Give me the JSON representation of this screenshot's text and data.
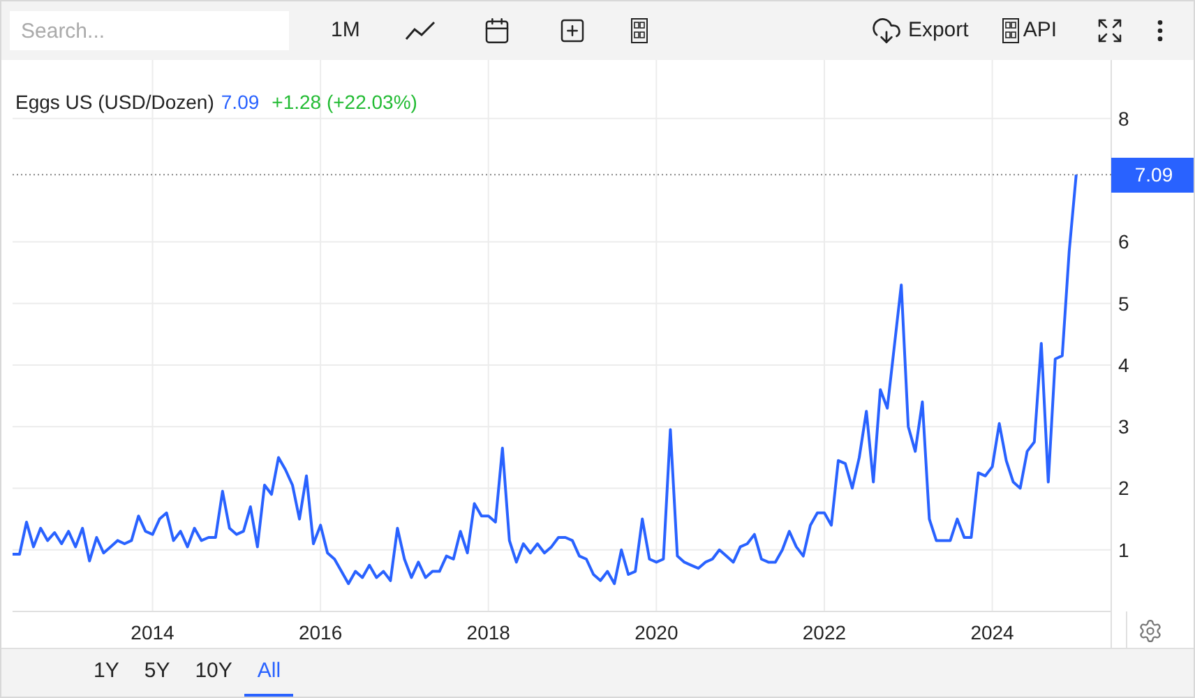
{
  "toolbar": {
    "search": {
      "placeholder": "Search..."
    },
    "interval": "1M",
    "export": "Export",
    "api": "API"
  },
  "legend": {
    "value": "7.09",
    "change": "+1.28 (+22.03%)"
  },
  "price_tag": "7.09",
  "chart_data": {
    "type": "line",
    "x": [
      "2012-05",
      "2012-06",
      "2012-07",
      "2012-08",
      "2012-09",
      "2012-10",
      "2012-11",
      "2012-12",
      "2013-01",
      "2013-02",
      "2013-03",
      "2013-04",
      "2013-05",
      "2013-06",
      "2013-07",
      "2013-08",
      "2013-09",
      "2013-10",
      "2013-11",
      "2013-12",
      "2014-01",
      "2014-02",
      "2014-03",
      "2014-04",
      "2014-05",
      "2014-06",
      "2014-07",
      "2014-08",
      "2014-09",
      "2014-10",
      "2014-11",
      "2014-12",
      "2015-01",
      "2015-02",
      "2015-03",
      "2015-04",
      "2015-05",
      "2015-06",
      "2015-07",
      "2015-08",
      "2015-09",
      "2015-10",
      "2015-11",
      "2015-12",
      "2016-01",
      "2016-02",
      "2016-03",
      "2016-04",
      "2016-05",
      "2016-06",
      "2016-07",
      "2016-08",
      "2016-09",
      "2016-10",
      "2016-11",
      "2016-12",
      "2017-01",
      "2017-02",
      "2017-03",
      "2017-04",
      "2017-05",
      "2017-06",
      "2017-07",
      "2017-08",
      "2017-09",
      "2017-10",
      "2017-11",
      "2017-12",
      "2018-01",
      "2018-02",
      "2018-03",
      "2018-04",
      "2018-05",
      "2018-06",
      "2018-07",
      "2018-08",
      "2018-09",
      "2018-10",
      "2018-11",
      "2018-12",
      "2019-01",
      "2019-02",
      "2019-03",
      "2019-04",
      "2019-05",
      "2019-06",
      "2019-07",
      "2019-08",
      "2019-09",
      "2019-10",
      "2019-11",
      "2019-12",
      "2020-01",
      "2020-02",
      "2020-03",
      "2020-04",
      "2020-05",
      "2020-06",
      "2020-07",
      "2020-08",
      "2020-09",
      "2020-10",
      "2020-11",
      "2020-12",
      "2021-01",
      "2021-02",
      "2021-03",
      "2021-04",
      "2021-05",
      "2021-06",
      "2021-07",
      "2021-08",
      "2021-09",
      "2021-10",
      "2021-11",
      "2021-12",
      "2022-01",
      "2022-02",
      "2022-03",
      "2022-04",
      "2022-05",
      "2022-06",
      "2022-07",
      "2022-08",
      "2022-09",
      "2022-10",
      "2022-11",
      "2022-12",
      "2023-01",
      "2023-02",
      "2023-03",
      "2023-04",
      "2023-05",
      "2023-06",
      "2023-07",
      "2023-08",
      "2023-09",
      "2023-10",
      "2023-11",
      "2023-12",
      "2024-01",
      "2024-02",
      "2024-03",
      "2024-04",
      "2024-05",
      "2024-06",
      "2024-07",
      "2024-08",
      "2024-09",
      "2024-10",
      "2024-11",
      "2024-12",
      "2025-01"
    ],
    "series": [
      {
        "name": "Eggs US (USD/Dozen)",
        "color": "#2962ff",
        "values": [
          0.93,
          0.93,
          1.45,
          1.05,
          1.35,
          1.15,
          1.28,
          1.1,
          1.3,
          1.05,
          1.35,
          0.82,
          1.2,
          0.95,
          1.05,
          1.15,
          1.1,
          1.15,
          1.55,
          1.3,
          1.25,
          1.5,
          1.6,
          1.15,
          1.3,
          1.05,
          1.35,
          1.15,
          1.2,
          1.2,
          1.95,
          1.35,
          1.25,
          1.3,
          1.7,
          1.05,
          2.05,
          1.9,
          2.5,
          2.3,
          2.05,
          1.5,
          2.2,
          1.1,
          1.4,
          0.95,
          0.85,
          0.65,
          0.45,
          0.65,
          0.55,
          0.75,
          0.55,
          0.65,
          0.5,
          1.35,
          0.85,
          0.55,
          0.8,
          0.55,
          0.65,
          0.65,
          0.9,
          0.85,
          1.3,
          0.95,
          1.75,
          1.55,
          1.55,
          1.45,
          2.65,
          1.15,
          0.8,
          1.1,
          0.95,
          1.1,
          0.95,
          1.05,
          1.2,
          1.2,
          1.15,
          0.9,
          0.85,
          0.6,
          0.5,
          0.65,
          0.45,
          1.0,
          0.6,
          0.65,
          1.5,
          0.85,
          0.8,
          0.85,
          2.95,
          0.9,
          0.8,
          0.75,
          0.7,
          0.8,
          0.85,
          1.0,
          0.9,
          0.8,
          1.05,
          1.1,
          1.25,
          0.85,
          0.8,
          0.8,
          1.0,
          1.3,
          1.05,
          0.9,
          1.4,
          1.6,
          1.6,
          1.4,
          2.45,
          2.4,
          2.0,
          2.5,
          3.25,
          2.1,
          3.6,
          3.3,
          4.3,
          5.3,
          3.0,
          2.6,
          3.4,
          1.5,
          1.15,
          1.15,
          1.15,
          1.5,
          1.2,
          1.2,
          2.25,
          2.2,
          2.35,
          3.05,
          2.45,
          2.1,
          2.0,
          2.6,
          2.75,
          4.35,
          2.1,
          4.1,
          4.15,
          5.85,
          7.09
        ]
      }
    ],
    "xticks": [
      {
        "value": "2014-01",
        "label": "2014"
      },
      {
        "value": "2016-01",
        "label": "2016"
      },
      {
        "value": "2018-01",
        "label": "2018"
      },
      {
        "value": "2020-01",
        "label": "2020"
      },
      {
        "value": "2022-01",
        "label": "2022"
      },
      {
        "value": "2024-01",
        "label": "2024"
      }
    ],
    "yticks": [
      1,
      2,
      3,
      4,
      5,
      6,
      8
    ],
    "xlim": [
      "2012-05",
      "2025-06"
    ],
    "ylim": [
      0,
      8.95
    ],
    "grid": true,
    "ref_lines": [
      {
        "axis": "y",
        "value": 7.09
      }
    ]
  },
  "ranges": [
    {
      "label": "1Y",
      "selected": false
    },
    {
      "label": "5Y",
      "selected": false
    },
    {
      "label": "10Y",
      "selected": false
    },
    {
      "label": "All",
      "selected": true
    }
  ]
}
